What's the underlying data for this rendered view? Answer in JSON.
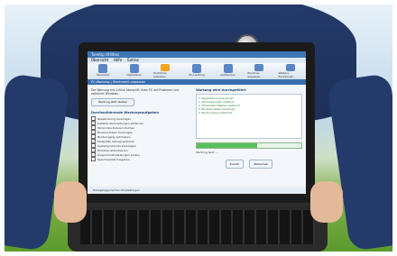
{
  "app": {
    "title": "TuneUp Utilities",
    "menu": [
      "Übersicht",
      "Hilfe",
      "Extras"
    ]
  },
  "toolbar": {
    "items": [
      "Übersicht",
      "Optimieren",
      "Probleme beheben",
      "PC-Leistung",
      "Aufräumen",
      "Windows anpassen",
      "Weitere Funktionen"
    ],
    "active_index": 2
  },
  "subbar": "PC-Wartung | Startmenü anpassen",
  "left": {
    "intro": "Die Wartung mit 1-Klick überprüft Ihren PC auf Probleme und optimiert Windows.",
    "scan_button": "Wartung jetzt starten",
    "section_title": "Durchzuführende Wartungsaufgaben",
    "tasks": [
      "Registrierung bereinigen",
      "Defekte Verknüpfungen entfernen",
      "Temporäre Dateien löschen",
      "Browser-Daten bereinigen",
      "Bootvorgang optimieren",
      "Festplatte defragmentieren",
      "Systemprotokolle bereinigen",
      "Windows aktualisieren",
      "Programmeinstellungen prüfen",
      "Speicherplatz freigeben"
    ]
  },
  "right": {
    "panel_title": "Wartung wird durchgeführt",
    "results": [
      "Registrierung bereinigt",
      "Verknüpfungen entfernt",
      "Temporäre Dateien gelöscht",
      "Browser-Daten bereinigt",
      "Bootvorgang optimiert"
    ],
    "progress_pct": 58,
    "status": "Wartung läuft …",
    "buttons": [
      "Zurück",
      "Abbrechen"
    ]
  },
  "bottombar": "Rückgängig machen     Einstellungen"
}
